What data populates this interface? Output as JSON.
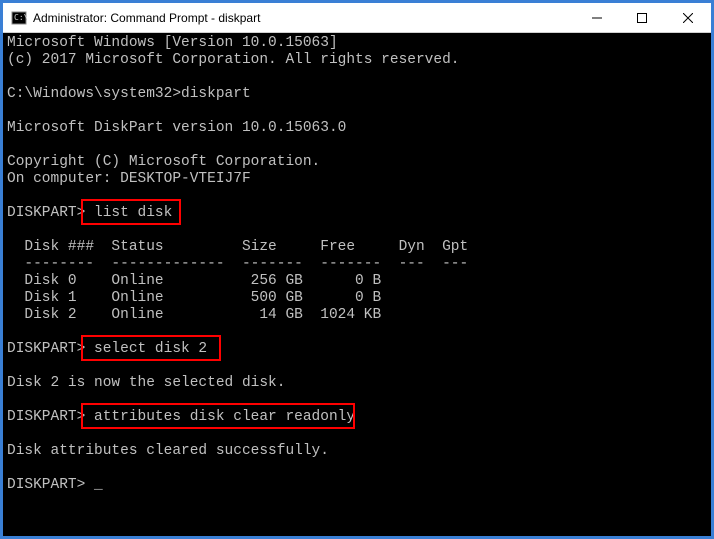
{
  "window": {
    "title": "Administrator: Command Prompt - diskpart"
  },
  "terminal": {
    "lines": {
      "l0": "Microsoft Windows [Version 10.0.15063]",
      "l1": "(c) 2017 Microsoft Corporation. All rights reserved.",
      "l2": "",
      "l3": "C:\\Windows\\system32>diskpart",
      "l4": "",
      "l5": "Microsoft DiskPart version 10.0.15063.0",
      "l6": "",
      "l7": "Copyright (C) Microsoft Corporation.",
      "l8": "On computer: DESKTOP-VTEIJ7F",
      "l9": "",
      "p1": "DISKPART> ",
      "c1": "list disk",
      "l11": "",
      "l12": "  Disk ###  Status         Size     Free     Dyn  Gpt",
      "l13": "  --------  -------------  -------  -------  ---  ---",
      "l14": "  Disk 0    Online          256 GB      0 B",
      "l15": "  Disk 1    Online          500 GB      0 B",
      "l16": "  Disk 2    Online           14 GB  1024 KB",
      "l17": "",
      "p2": "DISKPART> ",
      "c2": "select disk 2",
      "l19": "",
      "l20": "Disk 2 is now the selected disk.",
      "l21": "",
      "p3": "DISKPART> ",
      "c3": "attributes disk clear readonly",
      "l23": "",
      "l24": "Disk attributes cleared successfully.",
      "l25": "",
      "p4": "DISKPART> ",
      "cursor": "_"
    }
  }
}
